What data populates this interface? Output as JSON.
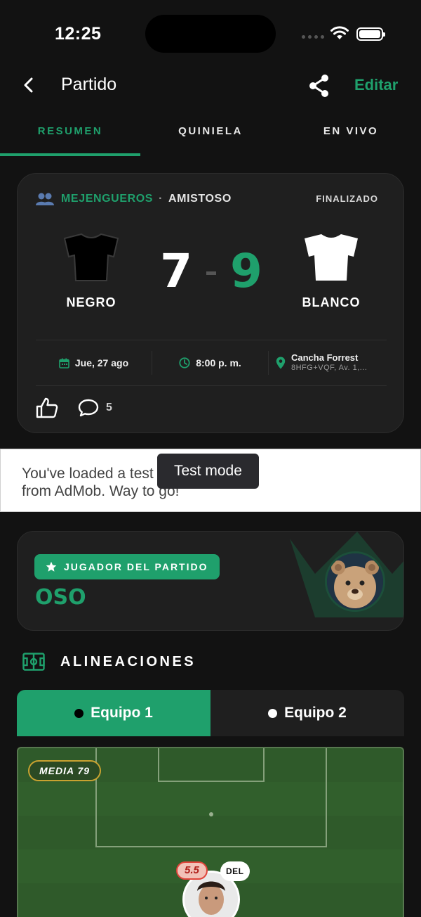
{
  "status_bar": {
    "time": "12:25"
  },
  "nav": {
    "title": "Partido",
    "edit_label": "Editar"
  },
  "tabs": [
    {
      "label": "RESUMEN",
      "active": true
    },
    {
      "label": "QUINIELA",
      "active": false
    },
    {
      "label": "EN VIVO",
      "active": false
    }
  ],
  "match": {
    "league": "MEJENGUEROS",
    "separator": "·",
    "type": "AMISTOSO",
    "status": "FINALIZADO",
    "home_team": {
      "name": "NEGRO",
      "jersey_color": "#000000"
    },
    "away_team": {
      "name": "BLANCO",
      "jersey_color": "#ffffff"
    },
    "home_score": "7",
    "away_score": "9",
    "date": "Jue, 27 ago",
    "time": "8:00 p. m.",
    "place_name": "Cancha Forrest",
    "place_address": "8HFG+VQF, Av. 1,...",
    "comments_count": "5"
  },
  "ad": {
    "text": "You've loaded a test ad from AdMob. Way to go!",
    "tooltip": "Test mode"
  },
  "mvp": {
    "badge": "JUGADOR DEL PARTIDO",
    "name": "OSO"
  },
  "lineups": {
    "title": "ALINEACIONES",
    "team1": "Equipo 1",
    "team2": "Equipo 2",
    "media": "MEDIA 79",
    "player_rating": "5.5",
    "player_position": "DEL"
  },
  "colors": {
    "accent": "#1fa06c",
    "background": "#121212",
    "card": "#1f1f1f",
    "pitch": "#2f5a2a"
  }
}
